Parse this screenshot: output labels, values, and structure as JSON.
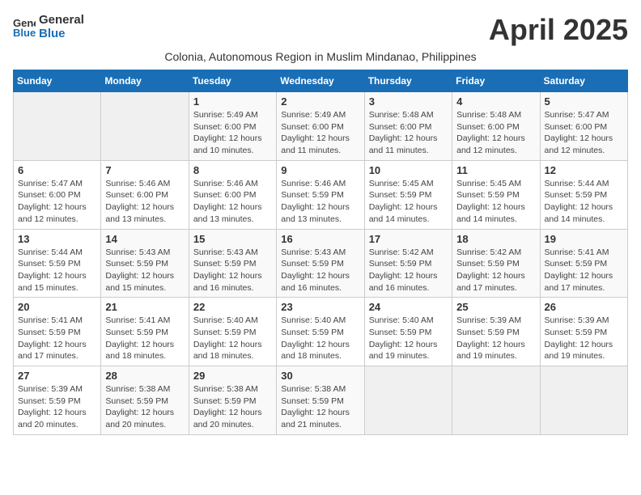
{
  "header": {
    "logo_line1": "General",
    "logo_line2": "Blue",
    "month_title": "April 2025",
    "subtitle": "Colonia, Autonomous Region in Muslim Mindanao, Philippines"
  },
  "weekdays": [
    "Sunday",
    "Monday",
    "Tuesday",
    "Wednesday",
    "Thursday",
    "Friday",
    "Saturday"
  ],
  "weeks": [
    [
      {
        "day": "",
        "text": ""
      },
      {
        "day": "",
        "text": ""
      },
      {
        "day": "1",
        "text": "Sunrise: 5:49 AM\nSunset: 6:00 PM\nDaylight: 12 hours\nand 10 minutes."
      },
      {
        "day": "2",
        "text": "Sunrise: 5:49 AM\nSunset: 6:00 PM\nDaylight: 12 hours\nand 11 minutes."
      },
      {
        "day": "3",
        "text": "Sunrise: 5:48 AM\nSunset: 6:00 PM\nDaylight: 12 hours\nand 11 minutes."
      },
      {
        "day": "4",
        "text": "Sunrise: 5:48 AM\nSunset: 6:00 PM\nDaylight: 12 hours\nand 12 minutes."
      },
      {
        "day": "5",
        "text": "Sunrise: 5:47 AM\nSunset: 6:00 PM\nDaylight: 12 hours\nand 12 minutes."
      }
    ],
    [
      {
        "day": "6",
        "text": "Sunrise: 5:47 AM\nSunset: 6:00 PM\nDaylight: 12 hours\nand 12 minutes."
      },
      {
        "day": "7",
        "text": "Sunrise: 5:46 AM\nSunset: 6:00 PM\nDaylight: 12 hours\nand 13 minutes."
      },
      {
        "day": "8",
        "text": "Sunrise: 5:46 AM\nSunset: 6:00 PM\nDaylight: 12 hours\nand 13 minutes."
      },
      {
        "day": "9",
        "text": "Sunrise: 5:46 AM\nSunset: 5:59 PM\nDaylight: 12 hours\nand 13 minutes."
      },
      {
        "day": "10",
        "text": "Sunrise: 5:45 AM\nSunset: 5:59 PM\nDaylight: 12 hours\nand 14 minutes."
      },
      {
        "day": "11",
        "text": "Sunrise: 5:45 AM\nSunset: 5:59 PM\nDaylight: 12 hours\nand 14 minutes."
      },
      {
        "day": "12",
        "text": "Sunrise: 5:44 AM\nSunset: 5:59 PM\nDaylight: 12 hours\nand 14 minutes."
      }
    ],
    [
      {
        "day": "13",
        "text": "Sunrise: 5:44 AM\nSunset: 5:59 PM\nDaylight: 12 hours\nand 15 minutes."
      },
      {
        "day": "14",
        "text": "Sunrise: 5:43 AM\nSunset: 5:59 PM\nDaylight: 12 hours\nand 15 minutes."
      },
      {
        "day": "15",
        "text": "Sunrise: 5:43 AM\nSunset: 5:59 PM\nDaylight: 12 hours\nand 16 minutes."
      },
      {
        "day": "16",
        "text": "Sunrise: 5:43 AM\nSunset: 5:59 PM\nDaylight: 12 hours\nand 16 minutes."
      },
      {
        "day": "17",
        "text": "Sunrise: 5:42 AM\nSunset: 5:59 PM\nDaylight: 12 hours\nand 16 minutes."
      },
      {
        "day": "18",
        "text": "Sunrise: 5:42 AM\nSunset: 5:59 PM\nDaylight: 12 hours\nand 17 minutes."
      },
      {
        "day": "19",
        "text": "Sunrise: 5:41 AM\nSunset: 5:59 PM\nDaylight: 12 hours\nand 17 minutes."
      }
    ],
    [
      {
        "day": "20",
        "text": "Sunrise: 5:41 AM\nSunset: 5:59 PM\nDaylight: 12 hours\nand 17 minutes."
      },
      {
        "day": "21",
        "text": "Sunrise: 5:41 AM\nSunset: 5:59 PM\nDaylight: 12 hours\nand 18 minutes."
      },
      {
        "day": "22",
        "text": "Sunrise: 5:40 AM\nSunset: 5:59 PM\nDaylight: 12 hours\nand 18 minutes."
      },
      {
        "day": "23",
        "text": "Sunrise: 5:40 AM\nSunset: 5:59 PM\nDaylight: 12 hours\nand 18 minutes."
      },
      {
        "day": "24",
        "text": "Sunrise: 5:40 AM\nSunset: 5:59 PM\nDaylight: 12 hours\nand 19 minutes."
      },
      {
        "day": "25",
        "text": "Sunrise: 5:39 AM\nSunset: 5:59 PM\nDaylight: 12 hours\nand 19 minutes."
      },
      {
        "day": "26",
        "text": "Sunrise: 5:39 AM\nSunset: 5:59 PM\nDaylight: 12 hours\nand 19 minutes."
      }
    ],
    [
      {
        "day": "27",
        "text": "Sunrise: 5:39 AM\nSunset: 5:59 PM\nDaylight: 12 hours\nand 20 minutes."
      },
      {
        "day": "28",
        "text": "Sunrise: 5:38 AM\nSunset: 5:59 PM\nDaylight: 12 hours\nand 20 minutes."
      },
      {
        "day": "29",
        "text": "Sunrise: 5:38 AM\nSunset: 5:59 PM\nDaylight: 12 hours\nand 20 minutes."
      },
      {
        "day": "30",
        "text": "Sunrise: 5:38 AM\nSunset: 5:59 PM\nDaylight: 12 hours\nand 21 minutes."
      },
      {
        "day": "",
        "text": ""
      },
      {
        "day": "",
        "text": ""
      },
      {
        "day": "",
        "text": ""
      }
    ]
  ]
}
